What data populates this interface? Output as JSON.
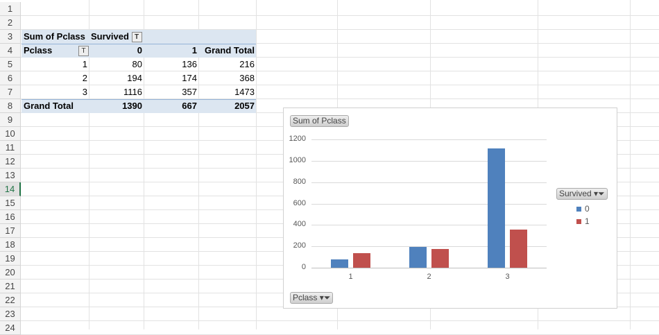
{
  "rows": [
    "1",
    "2",
    "3",
    "4",
    "5",
    "6",
    "7",
    "8",
    "9",
    "10",
    "11",
    "12",
    "13",
    "14",
    "15",
    "16",
    "17",
    "18",
    "19",
    "20",
    "21",
    "22",
    "23",
    "24"
  ],
  "selected_row": "14",
  "pivot": {
    "data_field": "Sum of Pclass",
    "column_field": "Survived",
    "row_field": "Pclass",
    "col_headers": [
      "0",
      "1",
      "Grand Total"
    ],
    "rows": [
      {
        "label": "1",
        "values": [
          "80",
          "136",
          "216"
        ]
      },
      {
        "label": "2",
        "values": [
          "194",
          "174",
          "368"
        ]
      },
      {
        "label": "3",
        "values": [
          "1116",
          "357",
          "1473"
        ]
      }
    ],
    "grand_total_label": "Grand Total",
    "grand_total": [
      "1390",
      "667",
      "2057"
    ]
  },
  "chart_data": {
    "type": "bar",
    "title": "Sum of Pclass",
    "xlabel": "Pclass",
    "legend_title": "Survived",
    "legend_position": "right",
    "categories": [
      "1",
      "2",
      "3"
    ],
    "series": [
      {
        "name": "0",
        "values": [
          80,
          194,
          1116
        ],
        "color": "#4f81bd"
      },
      {
        "name": "1",
        "values": [
          136,
          174,
          357
        ],
        "color": "#c0504d"
      }
    ],
    "yticks": [
      "0",
      "200",
      "400",
      "600",
      "800",
      "1000",
      "1200"
    ],
    "ylim": [
      0,
      1200
    ],
    "grid": true
  }
}
